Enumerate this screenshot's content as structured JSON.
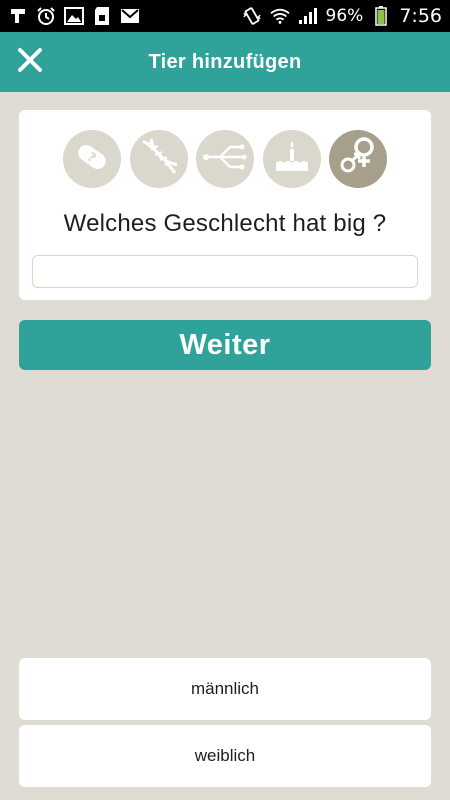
{
  "status_bar": {
    "battery_percent": "96%",
    "time": "7:56",
    "icons": [
      "app-notification-icon",
      "alarm-icon",
      "gallery-icon",
      "sd-card-icon",
      "gmail-icon",
      "vibrate-icon",
      "wifi-icon",
      "signal-icon",
      "battery-icon"
    ]
  },
  "app_bar": {
    "title": "Tier hinzufügen",
    "close_icon": "close-icon"
  },
  "steps": [
    {
      "icon": "pill-icon",
      "active": false
    },
    {
      "icon": "dna-icon",
      "active": false
    },
    {
      "icon": "branch-icon",
      "active": false
    },
    {
      "icon": "birthday-cake-icon",
      "active": false
    },
    {
      "icon": "gender-icon",
      "active": true
    }
  ],
  "question": {
    "text": "Welches Geschlecht hat big ?",
    "input_value": "",
    "input_placeholder": ""
  },
  "primary_button": {
    "label": "Weiter"
  },
  "options": [
    {
      "label": "männlich"
    },
    {
      "label": "weiblich"
    }
  ],
  "colors": {
    "accent": "#2fa399",
    "background": "#dfddd3",
    "step_inactive": "#dad7cc",
    "step_active": "#a59f8c"
  }
}
